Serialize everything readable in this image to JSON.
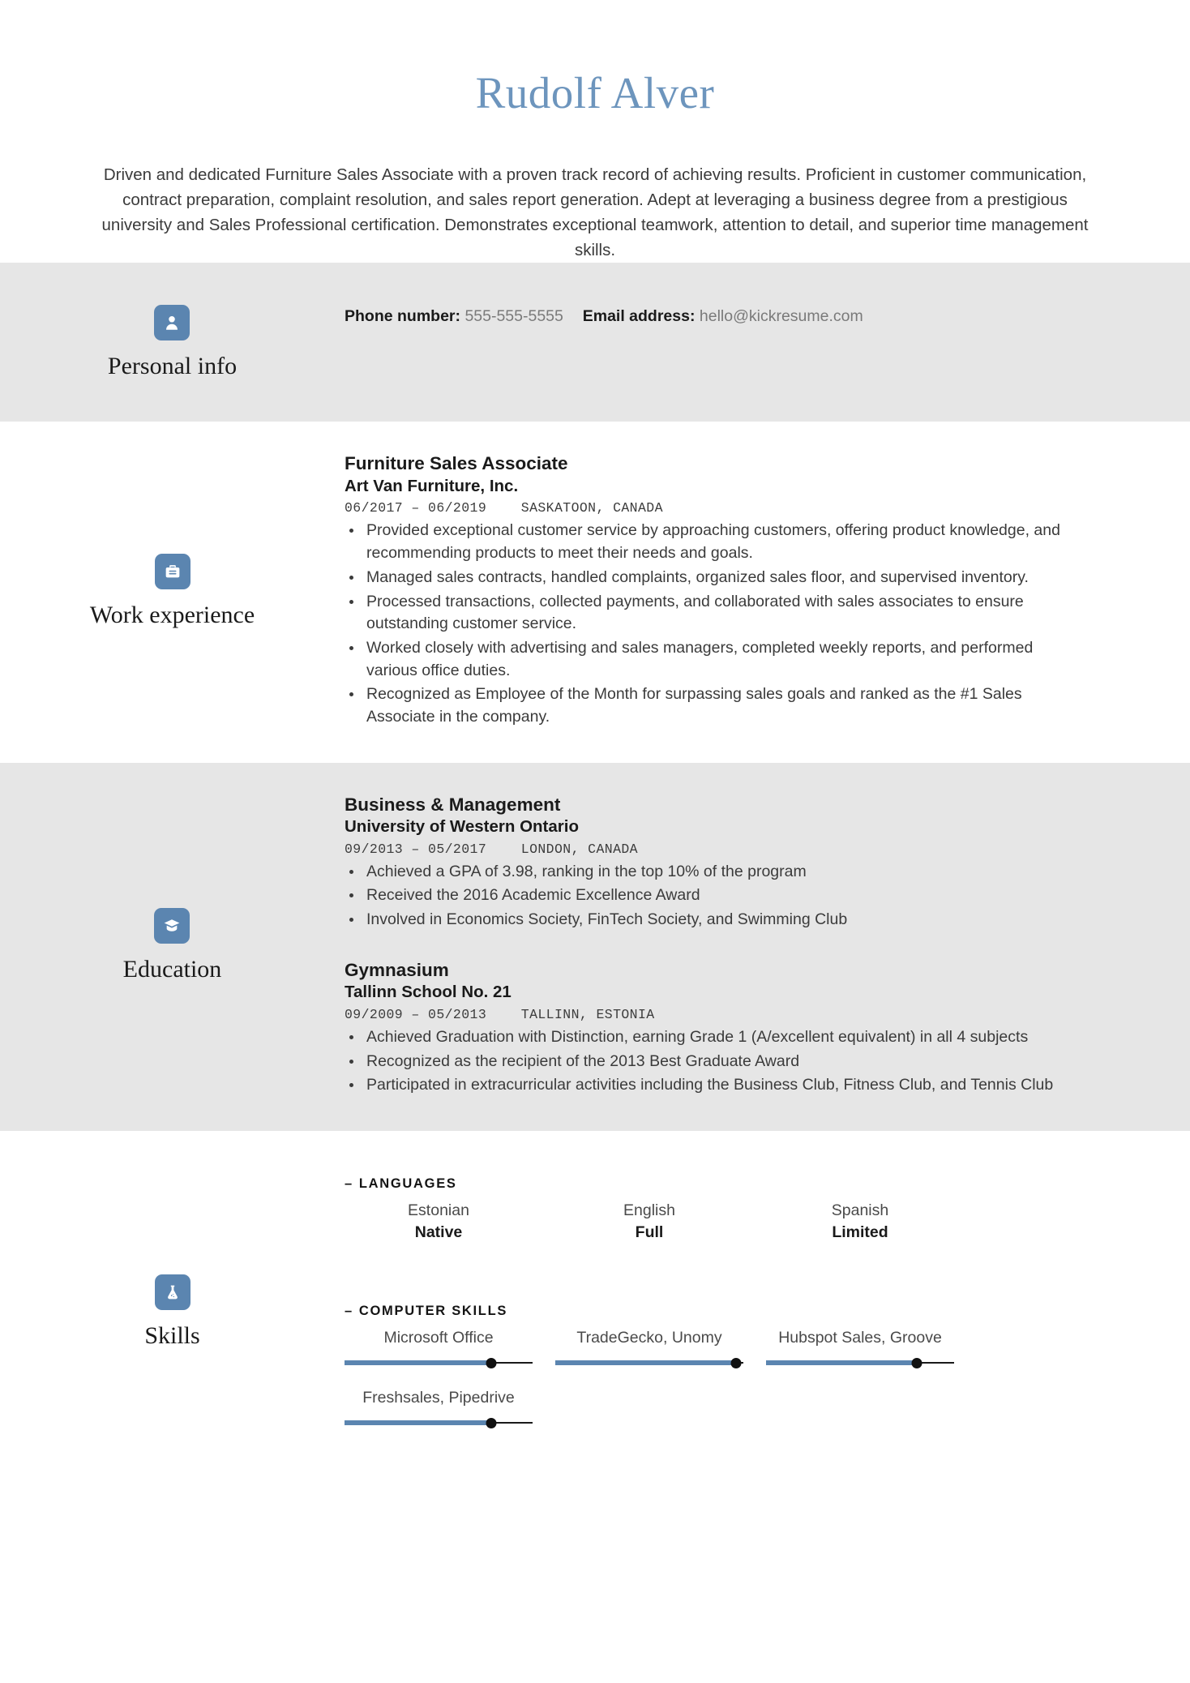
{
  "header": {
    "name": "Rudolf Alver",
    "summary": "Driven and dedicated Furniture Sales Associate with a proven track record of achieving results. Proficient in customer communication, contract preparation, complaint resolution, and sales report generation. Adept at leveraging a business degree from a prestigious university and Sales Professional certification. Demonstrates exceptional teamwork, attention to detail, and superior time management skills."
  },
  "colors": {
    "accent": "#6d95bd",
    "icon_bg": "#5b85b0",
    "shaded_bg": "#e6e6e6",
    "slider_fill": "#5b85b0"
  },
  "sections": {
    "personal_info": {
      "title": "Personal info",
      "icon": "person-icon",
      "phone_label": "Phone number:",
      "phone_value": "555-555-5555",
      "email_label": "Email address:",
      "email_value": "hello@kickresume.com"
    },
    "work_experience": {
      "title": "Work experience",
      "icon": "briefcase-icon",
      "entries": [
        {
          "title": "Furniture Sales Associate",
          "org": "Art Van Furniture, Inc.",
          "dates": "06/2017 – 06/2019",
          "location": "SASKATOON, CANADA",
          "bullets": [
            "Provided exceptional customer service by approaching customers, offering product knowledge, and recommending products to meet their needs and goals.",
            "Managed sales contracts, handled complaints, organized sales floor, and supervised inventory.",
            "Processed transactions, collected payments, and collaborated with sales associates to ensure outstanding customer service.",
            "Worked closely with advertising and sales managers, completed weekly reports, and performed various office duties.",
            "Recognized as Employee of the Month for surpassing sales goals and ranked as the #1 Sales Associate in the company."
          ]
        }
      ]
    },
    "education": {
      "title": "Education",
      "icon": "graduation-cap-icon",
      "entries": [
        {
          "title": "Business & Management",
          "org": "University of Western Ontario",
          "dates": "09/2013 – 05/2017",
          "location": "LONDON, CANADA",
          "bullets": [
            "Achieved a GPA of 3.98, ranking in the top 10% of the program",
            "Received the 2016 Academic Excellence Award",
            "Involved in Economics Society, FinTech Society, and Swimming Club"
          ]
        },
        {
          "title": "Gymnasium",
          "org": "Tallinn School No. 21",
          "dates": "09/2009 – 05/2013",
          "location": "TALLINN, ESTONIA",
          "bullets": [
            "Achieved Graduation with Distinction, earning Grade 1 (A/excellent equivalent) in all 4 subjects",
            "Recognized as the recipient of the 2013 Best Graduate Award",
            "Participated in extracurricular activities including the Business Club, Fitness Club, and Tennis Club"
          ]
        }
      ]
    },
    "skills": {
      "title": "Skills",
      "icon": "flask-icon",
      "groups": [
        {
          "label": "LANGUAGES",
          "dash": "–",
          "type": "levels",
          "items": [
            {
              "name": "Estonian",
              "level": "Native"
            },
            {
              "name": "English",
              "level": "Full"
            },
            {
              "name": "Spanish",
              "level": "Limited"
            }
          ]
        },
        {
          "label": "COMPUTER SKILLS",
          "dash": "–",
          "type": "sliders",
          "items": [
            {
              "name": "Microsoft Office",
              "percent": 78
            },
            {
              "name": "TradeGecko, Unomy",
              "percent": 96
            },
            {
              "name": "Hubspot Sales, Groove",
              "percent": 80
            },
            {
              "name": "Freshsales, Pipedrive",
              "percent": 78
            }
          ]
        }
      ]
    }
  }
}
